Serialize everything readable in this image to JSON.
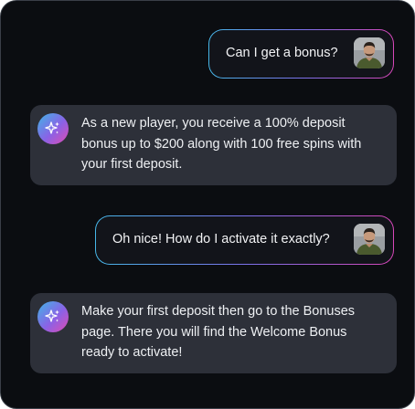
{
  "colors": {
    "background": "#0b0d11",
    "bot_bubble": "#2d3039",
    "accent_gradient": [
      "#46b7e8",
      "#7b72ec",
      "#d646b8"
    ]
  },
  "icons": {
    "bot": "sparkle-icon",
    "user": "user-avatar"
  },
  "messages": [
    {
      "role": "user",
      "text": "Can I get a bonus?"
    },
    {
      "role": "assistant",
      "lines": [
        "As a new player, you receive a 100% deposit",
        "bonus up to $200 along with 100 free spins with",
        "your first deposit."
      ]
    },
    {
      "role": "user",
      "text": "Oh nice! How do I activate it exactly?"
    },
    {
      "role": "assistant",
      "lines": [
        "Make your first deposit then go to the Bonuses",
        "page. There you will find the Welcome Bonus",
        "ready to activate!"
      ]
    }
  ]
}
